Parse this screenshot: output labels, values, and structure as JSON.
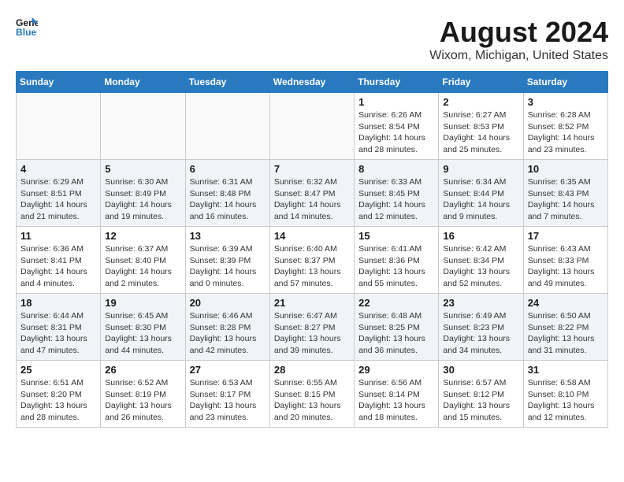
{
  "header": {
    "logo_line1": "General",
    "logo_line2": "Blue",
    "month_title": "August 2024",
    "location": "Wixom, Michigan, United States"
  },
  "weekdays": [
    "Sunday",
    "Monday",
    "Tuesday",
    "Wednesday",
    "Thursday",
    "Friday",
    "Saturday"
  ],
  "weeks": [
    [
      {
        "day": "",
        "info": ""
      },
      {
        "day": "",
        "info": ""
      },
      {
        "day": "",
        "info": ""
      },
      {
        "day": "",
        "info": ""
      },
      {
        "day": "1",
        "info": "Sunrise: 6:26 AM\nSunset: 8:54 PM\nDaylight: 14 hours\nand 28 minutes."
      },
      {
        "day": "2",
        "info": "Sunrise: 6:27 AM\nSunset: 8:53 PM\nDaylight: 14 hours\nand 25 minutes."
      },
      {
        "day": "3",
        "info": "Sunrise: 6:28 AM\nSunset: 8:52 PM\nDaylight: 14 hours\nand 23 minutes."
      }
    ],
    [
      {
        "day": "4",
        "info": "Sunrise: 6:29 AM\nSunset: 8:51 PM\nDaylight: 14 hours\nand 21 minutes."
      },
      {
        "day": "5",
        "info": "Sunrise: 6:30 AM\nSunset: 8:49 PM\nDaylight: 14 hours\nand 19 minutes."
      },
      {
        "day": "6",
        "info": "Sunrise: 6:31 AM\nSunset: 8:48 PM\nDaylight: 14 hours\nand 16 minutes."
      },
      {
        "day": "7",
        "info": "Sunrise: 6:32 AM\nSunset: 8:47 PM\nDaylight: 14 hours\nand 14 minutes."
      },
      {
        "day": "8",
        "info": "Sunrise: 6:33 AM\nSunset: 8:45 PM\nDaylight: 14 hours\nand 12 minutes."
      },
      {
        "day": "9",
        "info": "Sunrise: 6:34 AM\nSunset: 8:44 PM\nDaylight: 14 hours\nand 9 minutes."
      },
      {
        "day": "10",
        "info": "Sunrise: 6:35 AM\nSunset: 8:43 PM\nDaylight: 14 hours\nand 7 minutes."
      }
    ],
    [
      {
        "day": "11",
        "info": "Sunrise: 6:36 AM\nSunset: 8:41 PM\nDaylight: 14 hours\nand 4 minutes."
      },
      {
        "day": "12",
        "info": "Sunrise: 6:37 AM\nSunset: 8:40 PM\nDaylight: 14 hours\nand 2 minutes."
      },
      {
        "day": "13",
        "info": "Sunrise: 6:39 AM\nSunset: 8:39 PM\nDaylight: 14 hours\nand 0 minutes."
      },
      {
        "day": "14",
        "info": "Sunrise: 6:40 AM\nSunset: 8:37 PM\nDaylight: 13 hours\nand 57 minutes."
      },
      {
        "day": "15",
        "info": "Sunrise: 6:41 AM\nSunset: 8:36 PM\nDaylight: 13 hours\nand 55 minutes."
      },
      {
        "day": "16",
        "info": "Sunrise: 6:42 AM\nSunset: 8:34 PM\nDaylight: 13 hours\nand 52 minutes."
      },
      {
        "day": "17",
        "info": "Sunrise: 6:43 AM\nSunset: 8:33 PM\nDaylight: 13 hours\nand 49 minutes."
      }
    ],
    [
      {
        "day": "18",
        "info": "Sunrise: 6:44 AM\nSunset: 8:31 PM\nDaylight: 13 hours\nand 47 minutes."
      },
      {
        "day": "19",
        "info": "Sunrise: 6:45 AM\nSunset: 8:30 PM\nDaylight: 13 hours\nand 44 minutes."
      },
      {
        "day": "20",
        "info": "Sunrise: 6:46 AM\nSunset: 8:28 PM\nDaylight: 13 hours\nand 42 minutes."
      },
      {
        "day": "21",
        "info": "Sunrise: 6:47 AM\nSunset: 8:27 PM\nDaylight: 13 hours\nand 39 minutes."
      },
      {
        "day": "22",
        "info": "Sunrise: 6:48 AM\nSunset: 8:25 PM\nDaylight: 13 hours\nand 36 minutes."
      },
      {
        "day": "23",
        "info": "Sunrise: 6:49 AM\nSunset: 8:23 PM\nDaylight: 13 hours\nand 34 minutes."
      },
      {
        "day": "24",
        "info": "Sunrise: 6:50 AM\nSunset: 8:22 PM\nDaylight: 13 hours\nand 31 minutes."
      }
    ],
    [
      {
        "day": "25",
        "info": "Sunrise: 6:51 AM\nSunset: 8:20 PM\nDaylight: 13 hours\nand 28 minutes."
      },
      {
        "day": "26",
        "info": "Sunrise: 6:52 AM\nSunset: 8:19 PM\nDaylight: 13 hours\nand 26 minutes."
      },
      {
        "day": "27",
        "info": "Sunrise: 6:53 AM\nSunset: 8:17 PM\nDaylight: 13 hours\nand 23 minutes."
      },
      {
        "day": "28",
        "info": "Sunrise: 6:55 AM\nSunset: 8:15 PM\nDaylight: 13 hours\nand 20 minutes."
      },
      {
        "day": "29",
        "info": "Sunrise: 6:56 AM\nSunset: 8:14 PM\nDaylight: 13 hours\nand 18 minutes."
      },
      {
        "day": "30",
        "info": "Sunrise: 6:57 AM\nSunset: 8:12 PM\nDaylight: 13 hours\nand 15 minutes."
      },
      {
        "day": "31",
        "info": "Sunrise: 6:58 AM\nSunset: 8:10 PM\nDaylight: 13 hours\nand 12 minutes."
      }
    ]
  ]
}
